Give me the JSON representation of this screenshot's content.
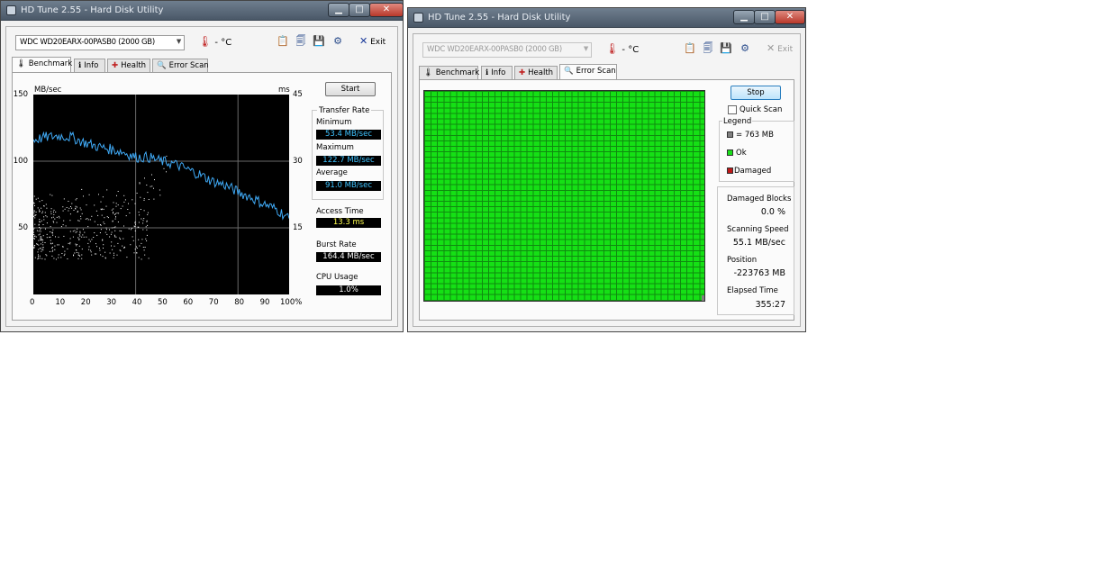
{
  "window_benchmark": {
    "title": "HD Tune 2.55 - Hard Disk Utility",
    "controls": {
      "minimize": "▁",
      "maximize": "□",
      "close": "✕"
    },
    "toolbar": {
      "drive": "WDC WD20EARX-00PASB0 (2000 GB)",
      "temperature": "- °C",
      "exit_label": "Exit"
    },
    "tabs": [
      "Benchmark",
      "Info",
      "Health",
      "Error Scan"
    ],
    "active_tab": "Benchmark",
    "start_button": "Start",
    "transfer_rate": {
      "header": "Transfer Rate",
      "minimum_label": "Minimum",
      "minimum": "53.4 MB/sec",
      "maximum_label": "Maximum",
      "maximum": "122.7 MB/sec",
      "average_label": "Average",
      "average": "91.0 MB/sec"
    },
    "access_time_label": "Access Time",
    "access_time": "13.3 ms",
    "burst_rate_label": "Burst Rate",
    "burst_rate": "164.4 MB/sec",
    "cpu_usage_label": "CPU Usage",
    "cpu_usage": "1.0%"
  },
  "chart_data": {
    "type": "line",
    "ylabel": "MB/sec",
    "y2label": "ms",
    "ylim": [
      0,
      150
    ],
    "y2lim": [
      0,
      45
    ],
    "y_ticks": [
      "150",
      "100",
      "50"
    ],
    "y2_ticks": [
      "45",
      "30",
      "15"
    ],
    "xlim": [
      0,
      100
    ],
    "x_ticks": [
      "0",
      "10",
      "20",
      "30",
      "40",
      "50",
      "60",
      "70",
      "80",
      "90",
      "100%"
    ],
    "grid": true,
    "series": [
      {
        "color": "#3fa9f5",
        "x": [
          0,
          5,
          10,
          15,
          20,
          25,
          30,
          35,
          40,
          45,
          50,
          55,
          60,
          65,
          70,
          75,
          80,
          85,
          90,
          95,
          100
        ],
        "values": [
          116,
          118,
          119,
          118,
          114,
          111,
          109,
          107,
          103,
          103,
          100,
          98,
          94,
          90,
          85,
          82,
          77,
          73,
          68,
          64,
          57
        ]
      }
    ],
    "access_scatter": {
      "color": "#ffffff",
      "x_range": [
        0,
        45
      ],
      "ms_range": [
        8,
        24
      ]
    }
  },
  "window_scan": {
    "title": "HD Tune 2.55 - Hard Disk Utility",
    "controls": {
      "minimize": "▁",
      "maximize": "□",
      "close": "✕"
    },
    "toolbar": {
      "drive": "WDC WD20EARX-00PASB0 (2000 GB)",
      "temperature": "- °C",
      "exit_label": "Exit"
    },
    "tabs": [
      "Benchmark",
      "Info",
      "Health",
      "Error Scan"
    ],
    "active_tab": "Error Scan",
    "stop_button": "Stop",
    "quick_scan_label": "Quick Scan",
    "quick_scan_checked": false,
    "legend_header": "Legend",
    "legend": [
      {
        "label": "= 763 MB",
        "color": "#808080"
      },
      {
        "label": "Ok",
        "color": "#19e019"
      },
      {
        "label": "Damaged",
        "color": "#c01818"
      }
    ],
    "damaged_blocks_label": "Damaged Blocks",
    "damaged_blocks": "0.0 %",
    "scanning_speed_label": "Scanning Speed",
    "scanning_speed": "55.1 MB/sec",
    "position_label": "Position",
    "position": "-223763 MB",
    "elapsed_label": "Elapsed Time",
    "elapsed": "355:27",
    "scan_progress": 0.99
  }
}
